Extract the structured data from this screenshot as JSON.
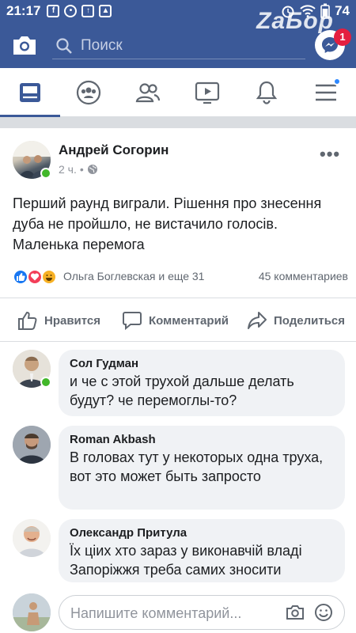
{
  "status_bar": {
    "time": "21:17",
    "battery": "74"
  },
  "watermark": {
    "text": "ZaБор",
    "badge": "1"
  },
  "search": {
    "placeholder": "Поиск"
  },
  "post": {
    "author": "Андрей Согорин",
    "time": "2 ч.",
    "text": "Перший раунд виграли. Рішення про знесення дуба не пройшло, не вистачило голосів. Маленька перемога",
    "reactions_names": "Ольга Боглевская и еще 31",
    "comments_count": "45 комментариев"
  },
  "actions": {
    "like": "Нравится",
    "comment": "Комментарий",
    "share": "Поделиться"
  },
  "comments": [
    {
      "name": "Сол Гудман",
      "text": "и че с этой трухой дальше делать будут? че перемоглы-то?"
    },
    {
      "name": "Roman Akbash",
      "text": "В головах тут у некоторых одна труха, вот это может быть запросто"
    },
    {
      "name": "Олександр Притула",
      "text": "Їх ціих хто зараз у виконавчій владі Запоріжжя треба самих зносити"
    }
  ],
  "composer": {
    "placeholder": "Напишите комментарий..."
  },
  "colors": {
    "brand": "#3b5998",
    "bubble": "#f0f2f5",
    "online": "#42b72a",
    "like": "#1877f2",
    "love": "#f33e58",
    "haha": "#f7b125"
  },
  "icons": [
    "camera-icon",
    "search-icon",
    "messenger-icon",
    "news-feed-icon",
    "groups-icon",
    "friends-icon",
    "watch-icon",
    "notifications-icon",
    "menu-icon",
    "globe-icon",
    "like-icon",
    "comment-icon",
    "share-icon",
    "emoji-icon"
  ]
}
